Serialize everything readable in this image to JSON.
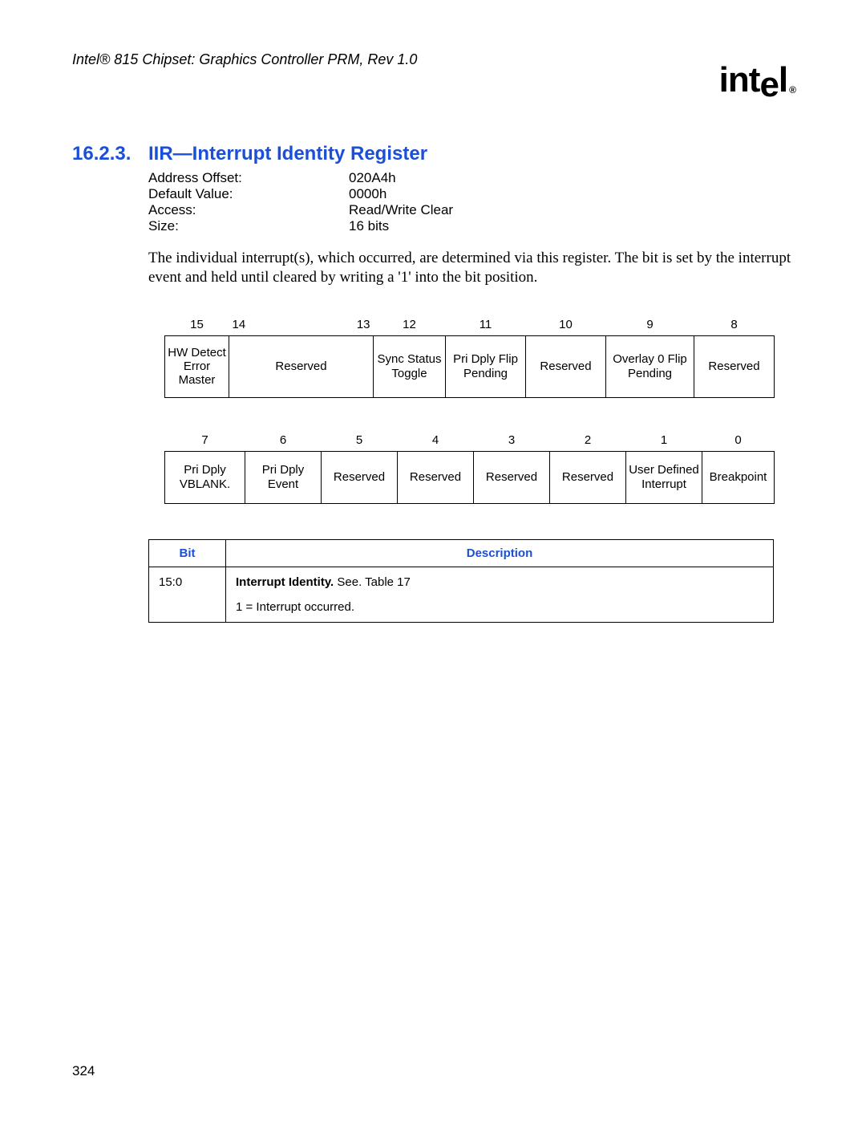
{
  "doc_header": "Intel® 815 Chipset: Graphics Controller PRM, Rev 1.0",
  "logo_text": "intel",
  "section": {
    "number": "16.2.3.",
    "title": "IIR—Interrupt Identity Register"
  },
  "props": {
    "address_offset_label": "Address Offset:",
    "address_offset_value": "020A4h",
    "default_value_label": "Default Value:",
    "default_value_value": "0000h",
    "access_label": "Access:",
    "access_value": "Read/Write Clear",
    "size_label": "Size:",
    "size_value": "16 bits"
  },
  "description_para": "The individual interrupt(s), which occurred, are determined via this register. The bit is set by the interrupt event and held until cleared by writing a '1' into the bit position.",
  "bits_high": {
    "headers": [
      "15",
      "14",
      "13",
      "12",
      "11",
      "10",
      "9",
      "8"
    ],
    "cells": [
      "HW Detect Error Master",
      "Reserved",
      "Sync Status Toggle",
      "Pri Dply Flip Pending",
      "Reserved",
      "Overlay 0 Flip Pending",
      "Reserved"
    ]
  },
  "bits_low": {
    "headers": [
      "7",
      "6",
      "5",
      "4",
      "3",
      "2",
      "1",
      "0"
    ],
    "cells": [
      "Pri Dply VBLANK.",
      "Pri Dply Event",
      "Reserved",
      "Reserved",
      "Reserved",
      "Reserved",
      "User Defined Interrupt",
      "Breakpoint"
    ]
  },
  "desc_table": {
    "bit_header": "Bit",
    "desc_header": "Description",
    "row": {
      "bit": "15:0",
      "bold": "Interrupt Identity.",
      "rest": " See. Table 17",
      "sub": "1 = Interrupt occurred."
    }
  },
  "page_number": "324"
}
